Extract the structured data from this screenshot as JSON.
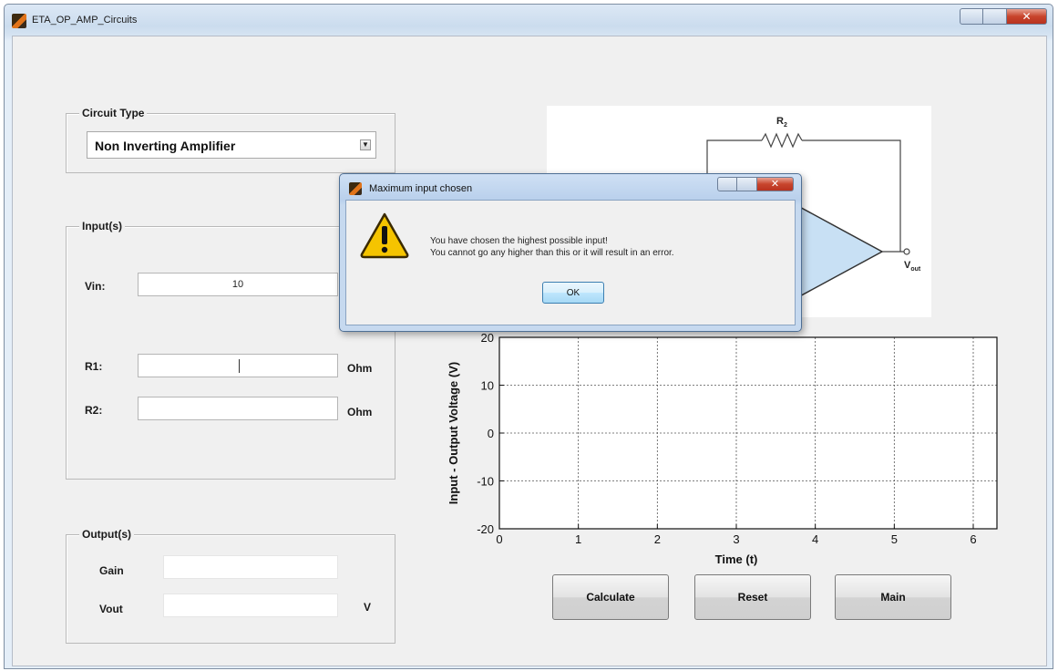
{
  "window": {
    "title": "ETA_OP_AMP_Circuits"
  },
  "circuit_type": {
    "title": "Circuit Type",
    "selected": "Non Inverting Amplifier"
  },
  "inputs": {
    "title": "Input(s)",
    "vin_label": "Vin:",
    "vin_value": "10",
    "r1_label": "R1:",
    "r1_unit": "Ohm",
    "r2_label": "R2:",
    "r2_unit": "Ohm"
  },
  "outputs": {
    "title": "Output(s)",
    "gain_label": "Gain",
    "vout_label": "Vout",
    "vout_unit": "V"
  },
  "schematic": {
    "r2_label": "R",
    "r2_sub": "2",
    "vout_label": "V",
    "vout_sub": "out"
  },
  "chart_data": {
    "type": "line",
    "xlabel": "Time (t)",
    "ylabel": "Input - Output Voltage (V)",
    "xlim": [
      0,
      6.3
    ],
    "ylim": [
      -20,
      20
    ],
    "x_ticks": [
      "0",
      "1",
      "2",
      "3",
      "4",
      "5",
      "6"
    ],
    "y_ticks": [
      "-20",
      "-10",
      "0",
      "10",
      "20"
    ],
    "grid": true,
    "series": []
  },
  "buttons": {
    "calculate": "Calculate",
    "reset": "Reset",
    "main": "Main"
  },
  "dialog": {
    "title": "Maximum input chosen",
    "line1": "You have chosen the highest possible input!",
    "line2": "You cannot go any higher than this or it will result in an error.",
    "ok": "OK"
  },
  "colors": {
    "amp_fill": "#c8e0f4",
    "warning_yellow": "#f5c400",
    "close_red": "#c8442c"
  }
}
